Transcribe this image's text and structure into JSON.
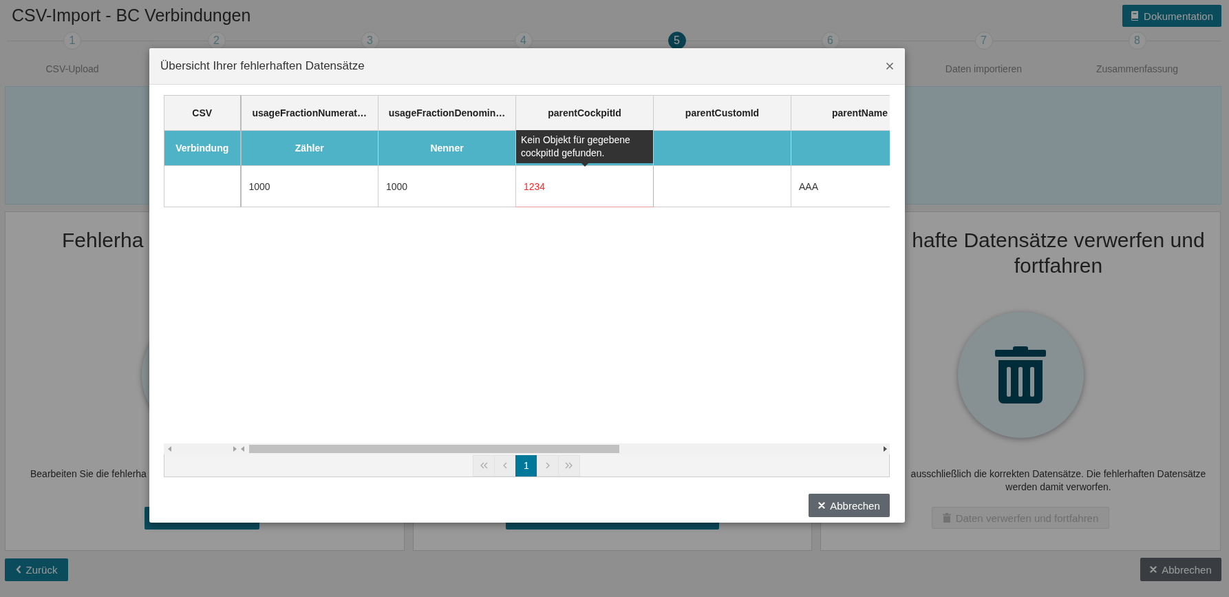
{
  "header": {
    "title": "CSV-Import - BC Verbindungen",
    "doc_button": "Dokumentation"
  },
  "steps": [
    {
      "number": "1",
      "label": "CSV-Upload",
      "selected": false
    },
    {
      "number": "2",
      "selected": false
    },
    {
      "number": "3",
      "selected": false
    },
    {
      "number": "4",
      "selected": false
    },
    {
      "number": "5",
      "selected": true
    },
    {
      "number": "6",
      "selected": false
    },
    {
      "number": "7",
      "label": "Daten importieren",
      "selected": false
    },
    {
      "number": "8",
      "label": "Zusammenfassung",
      "selected": false
    }
  ],
  "cards": [
    {
      "heading": "Fehlerha",
      "emblem": {
        "kind": "circle"
      },
      "description": "Bearbeiten Sie die fehlerha",
      "button": {
        "disabled": false
      }
    },
    {
      "button": {
        "disabled": false
      }
    },
    {
      "heading": "hafte Datensätze verwerfen und fortfahren",
      "emblem": {
        "kind": "trash"
      },
      "description": "ausschließlich die korrekten Datensätze. Die fehlerhaften Datensätze werden damit verworfen.",
      "button": {
        "label": "Daten verwerfen und fortfahren",
        "disabled": true
      }
    }
  ],
  "footer": {
    "back_button": "Zurück",
    "cancel_button": "Abbrechen"
  },
  "dialog": {
    "title": "Übersicht Ihrer fehlerhaften Datensätze",
    "columns": [
      {
        "header": "CSV",
        "subheader": "Verbindung"
      },
      {
        "header": "usageFractionNumerat…",
        "subheader": "Zähler"
      },
      {
        "header": "usageFractionDenomin…",
        "subheader": "Nenner"
      },
      {
        "header": "parentCockpitId"
      },
      {
        "header": "parentCustomId"
      },
      {
        "header": "parentName"
      }
    ],
    "rows": [
      {
        "cells": [
          {
            "error": false
          },
          {
            "text": "1000",
            "error": false
          },
          {
            "text": "1000",
            "error": false
          },
          {
            "text": "1234",
            "error": true,
            "tooltip": "Kein Objekt für gegebene cockpitId gefunden."
          },
          {
            "error": false
          },
          {
            "text": "AAA",
            "error": false
          }
        ]
      }
    ],
    "pagination": [
      {
        "kind": "first",
        "disabled": true
      },
      {
        "kind": "prev",
        "disabled": true
      },
      {
        "kind": "page",
        "label": "1",
        "selected": true,
        "disabled": false
      },
      {
        "kind": "next",
        "disabled": true
      },
      {
        "kind": "last",
        "disabled": true
      }
    ],
    "cancel_button": "Abbrechen"
  }
}
